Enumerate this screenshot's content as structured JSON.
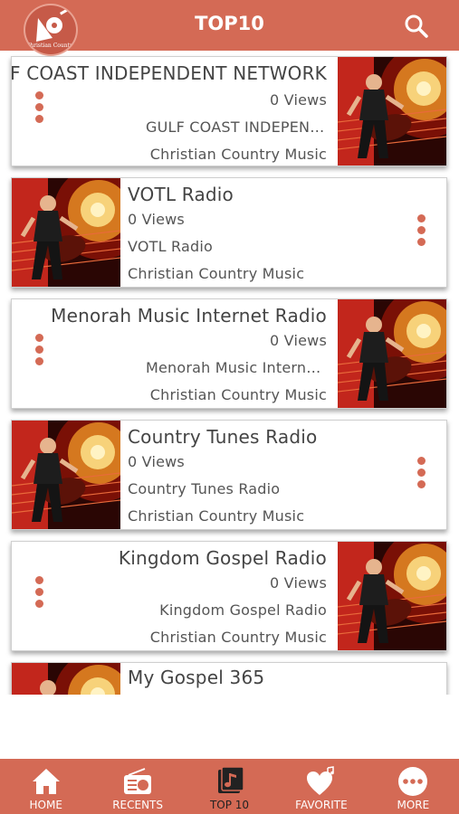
{
  "header": {
    "title": "TOP10",
    "logo_text": "Christian Country"
  },
  "stations": [
    {
      "name": "GULF COAST INDEPENDENT NETWORK",
      "views": "0 Views",
      "subtitle": "GULF COAST INDEPEND...",
      "genre": "Christian Country Music"
    },
    {
      "name": "VOTL Radio",
      "views": "0 Views",
      "subtitle": "VOTL Radio",
      "genre": "Christian Country Music"
    },
    {
      "name": "Menorah Music Internet Radio",
      "views": "0 Views",
      "subtitle": "Menorah Music Internet...",
      "genre": "Christian Country Music"
    },
    {
      "name": "Country Tunes Radio",
      "views": "0 Views",
      "subtitle": "Country Tunes Radio",
      "genre": "Christian Country Music"
    },
    {
      "name": "Kingdom Gospel Radio",
      "views": "0 Views",
      "subtitle": "Kingdom Gospel Radio",
      "genre": "Christian Country Music"
    },
    {
      "name": "My Gospel 365"
    }
  ],
  "tabs": [
    {
      "label": "HOME",
      "icon": "home-icon"
    },
    {
      "label": "RECENTS",
      "icon": "radio-icon"
    },
    {
      "label": "TOP 10",
      "icon": "music-note-icon"
    },
    {
      "label": "FAVORITE",
      "icon": "heart-music-icon"
    },
    {
      "label": "MORE",
      "icon": "more-icon"
    }
  ],
  "colors": {
    "accent": "#d46a55",
    "active_tab_text": "#222222"
  }
}
